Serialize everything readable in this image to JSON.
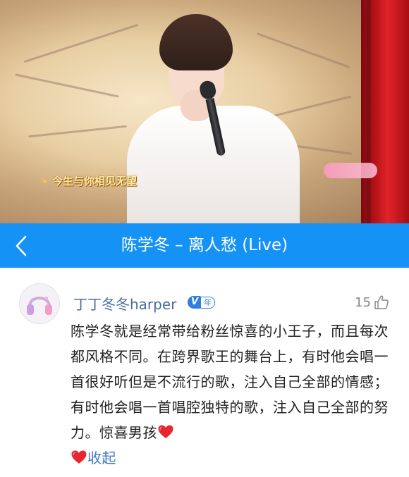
{
  "video": {
    "lyric_caption": "今生与你相见无望"
  },
  "header": {
    "back_icon": "chevron-left-icon",
    "title": "陈学冬 – 离人愁 (Live)",
    "background_color": "#1592f5"
  },
  "comment": {
    "username": "丁丁冬冬harper",
    "vip_badge": {
      "letter": "V",
      "label": "年"
    },
    "like_count": "15",
    "like_icon": "thumbs-up-icon",
    "text": "陈学冬就是经常带给粉丝惊喜的小王子，而且每次都风格不同。在跨界歌王的舞台上，有时他会唱一首很好听但是不流行的歌，注入自己全部的情感；有时他会唱一首唱腔独特的歌，注入自己全部的努力。惊喜男孩",
    "emoji_icons": [
      "red-heart-icon",
      "red-heart-icon"
    ],
    "collapse_label": "收起"
  }
}
